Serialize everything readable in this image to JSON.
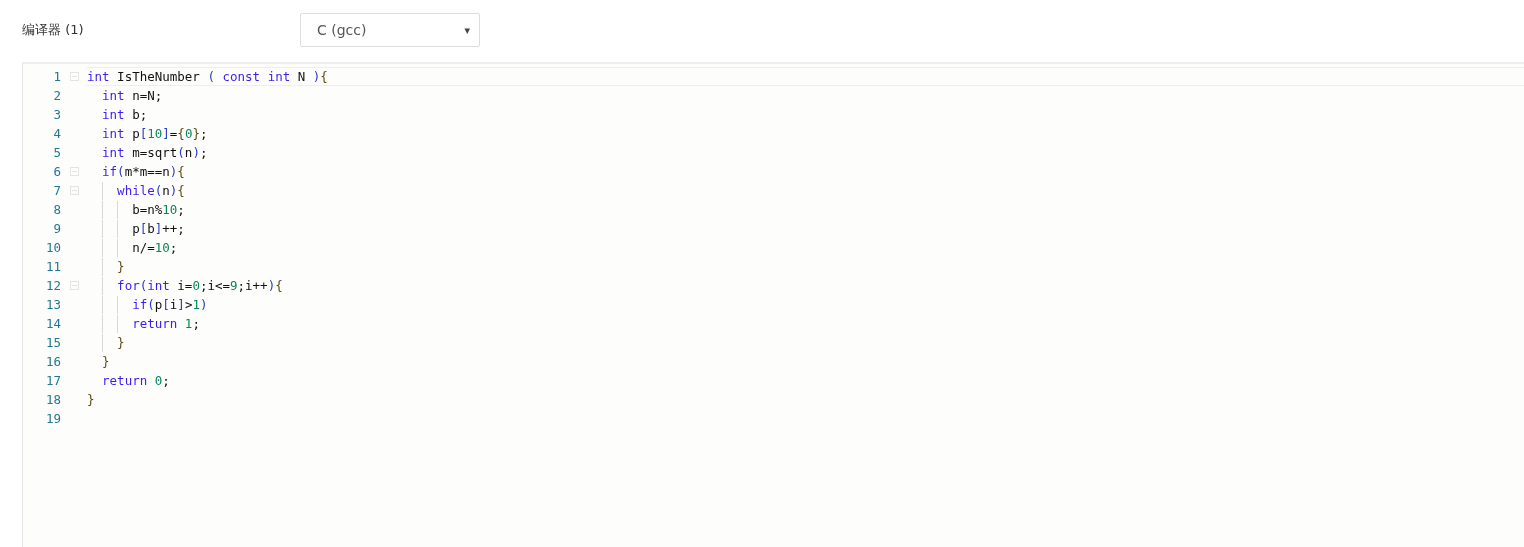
{
  "compiler": {
    "label": "编译器 (1)",
    "select_value": "C (gcc)",
    "caret": "▾"
  },
  "editor": {
    "lines": [
      {
        "number": "1",
        "foldable": true,
        "selected": true,
        "tokens": [
          {
            "kind": "kw",
            "text": "int"
          },
          {
            "kind": "plain",
            "text": " IsTheNumber "
          },
          {
            "kind": "paren",
            "text": "( "
          },
          {
            "kind": "kw",
            "text": "const "
          },
          {
            "kind": "kw",
            "text": "int"
          },
          {
            "kind": "plain",
            "text": " N "
          },
          {
            "kind": "paren",
            "text": ")"
          },
          {
            "kind": "brace",
            "text": "{"
          }
        ]
      },
      {
        "number": "2",
        "foldable": false,
        "selected": false,
        "tokens": [
          {
            "kind": "kw",
            "text": "  int"
          },
          {
            "kind": "plain",
            "text": " n=N;"
          }
        ]
      },
      {
        "number": "3",
        "foldable": false,
        "selected": false,
        "tokens": [
          {
            "kind": "kw",
            "text": "  int"
          },
          {
            "kind": "plain",
            "text": " b;"
          }
        ]
      },
      {
        "number": "4",
        "foldable": false,
        "selected": false,
        "tokens": [
          {
            "kind": "kw",
            "text": "  int"
          },
          {
            "kind": "plain",
            "text": " p"
          },
          {
            "kind": "paren",
            "text": "["
          },
          {
            "kind": "num",
            "text": "10"
          },
          {
            "kind": "paren",
            "text": "]"
          },
          {
            "kind": "plain",
            "text": "="
          },
          {
            "kind": "brace",
            "text": "{"
          },
          {
            "kind": "num",
            "text": "0"
          },
          {
            "kind": "brace",
            "text": "}"
          },
          {
            "kind": "plain",
            "text": ";"
          }
        ]
      },
      {
        "number": "5",
        "foldable": false,
        "selected": false,
        "tokens": [
          {
            "kind": "kw",
            "text": "  int"
          },
          {
            "kind": "plain",
            "text": " m=sqrt"
          },
          {
            "kind": "paren",
            "text": "("
          },
          {
            "kind": "plain",
            "text": "n"
          },
          {
            "kind": "paren",
            "text": ")"
          },
          {
            "kind": "plain",
            "text": ";"
          }
        ]
      },
      {
        "number": "6",
        "foldable": true,
        "selected": false,
        "tokens": [
          {
            "kind": "kw",
            "text": "  if"
          },
          {
            "kind": "paren",
            "text": "("
          },
          {
            "kind": "plain",
            "text": "m*m==n"
          },
          {
            "kind": "paren",
            "text": ")"
          },
          {
            "kind": "brace",
            "text": "{"
          }
        ]
      },
      {
        "number": "7",
        "foldable": true,
        "selected": false,
        "tokens": [
          {
            "kind": "kw",
            "text": "    while"
          },
          {
            "kind": "paren",
            "text": "("
          },
          {
            "kind": "plain",
            "text": "n"
          },
          {
            "kind": "paren",
            "text": ")"
          },
          {
            "kind": "brace",
            "text": "{"
          }
        ]
      },
      {
        "number": "8",
        "foldable": false,
        "selected": false,
        "tokens": [
          {
            "kind": "plain",
            "text": "      b=n%"
          },
          {
            "kind": "num",
            "text": "10"
          },
          {
            "kind": "plain",
            "text": ";"
          }
        ]
      },
      {
        "number": "9",
        "foldable": false,
        "selected": false,
        "tokens": [
          {
            "kind": "plain",
            "text": "      p"
          },
          {
            "kind": "paren",
            "text": "["
          },
          {
            "kind": "plain",
            "text": "b"
          },
          {
            "kind": "paren",
            "text": "]"
          },
          {
            "kind": "plain",
            "text": "++;"
          }
        ]
      },
      {
        "number": "10",
        "foldable": false,
        "selected": false,
        "tokens": [
          {
            "kind": "plain",
            "text": "      n/="
          },
          {
            "kind": "num",
            "text": "10"
          },
          {
            "kind": "plain",
            "text": ";"
          }
        ]
      },
      {
        "number": "11",
        "foldable": false,
        "selected": false,
        "tokens": [
          {
            "kind": "brace",
            "text": "    }"
          }
        ]
      },
      {
        "number": "12",
        "foldable": true,
        "selected": false,
        "tokens": [
          {
            "kind": "kw",
            "text": "    for"
          },
          {
            "kind": "paren",
            "text": "("
          },
          {
            "kind": "kw",
            "text": "int"
          },
          {
            "kind": "plain",
            "text": " i="
          },
          {
            "kind": "num",
            "text": "0"
          },
          {
            "kind": "plain",
            "text": ";i<="
          },
          {
            "kind": "num",
            "text": "9"
          },
          {
            "kind": "plain",
            "text": ";i++"
          },
          {
            "kind": "paren",
            "text": ")"
          },
          {
            "kind": "brace",
            "text": "{"
          }
        ]
      },
      {
        "number": "13",
        "foldable": false,
        "selected": false,
        "tokens": [
          {
            "kind": "kw",
            "text": "      if"
          },
          {
            "kind": "paren",
            "text": "("
          },
          {
            "kind": "plain",
            "text": "p"
          },
          {
            "kind": "paren",
            "text": "["
          },
          {
            "kind": "plain",
            "text": "i"
          },
          {
            "kind": "paren",
            "text": "]"
          },
          {
            "kind": "plain",
            "text": ">"
          },
          {
            "kind": "num",
            "text": "1"
          },
          {
            "kind": "paren",
            "text": ")"
          }
        ]
      },
      {
        "number": "14",
        "foldable": false,
        "selected": false,
        "tokens": [
          {
            "kind": "kw",
            "text": "      return"
          },
          {
            "kind": "num",
            "text": " 1"
          },
          {
            "kind": "plain",
            "text": ";"
          }
        ]
      },
      {
        "number": "15",
        "foldable": false,
        "selected": false,
        "tokens": [
          {
            "kind": "brace",
            "text": "    }"
          }
        ]
      },
      {
        "number": "16",
        "foldable": false,
        "selected": false,
        "tokens": [
          {
            "kind": "brace",
            "text": "  }"
          }
        ]
      },
      {
        "number": "17",
        "foldable": false,
        "selected": false,
        "tokens": [
          {
            "kind": "kw",
            "text": "  return"
          },
          {
            "kind": "num",
            "text": " 0"
          },
          {
            "kind": "plain",
            "text": ";"
          }
        ]
      },
      {
        "number": "18",
        "foldable": false,
        "selected": false,
        "tokens": [
          {
            "kind": "brace",
            "text": "}"
          }
        ]
      },
      {
        "number": "19",
        "foldable": false,
        "selected": false
      }
    ]
  }
}
